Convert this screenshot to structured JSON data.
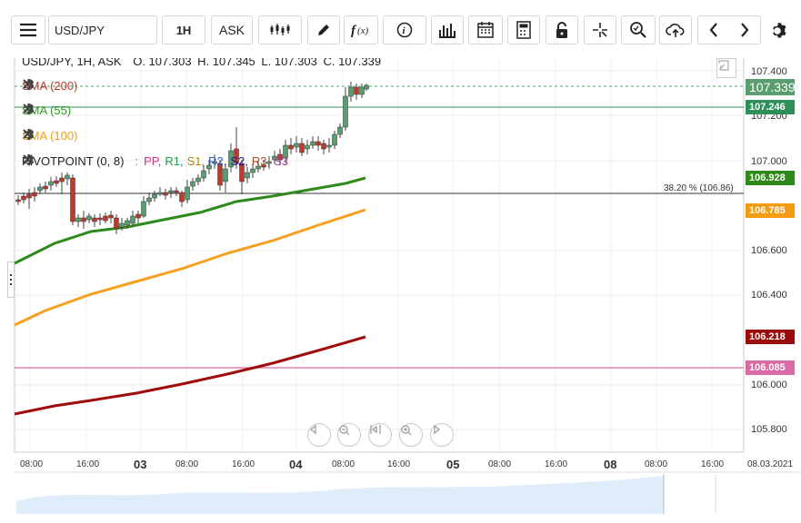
{
  "toolbar": {
    "symbol": "USD/JPY",
    "timeframe": "1H",
    "price_type": "ASK"
  },
  "header": {
    "title": "USD/JPY, 1H, ASK",
    "open": "O. 107.303",
    "high": "H. 107.345",
    "low": "L. 107.303",
    "close": "C. 107.339"
  },
  "indicators": {
    "sma200": {
      "label": "SMA (200)",
      "color": "#c0392b"
    },
    "sma55": {
      "label": "SMA (55)",
      "color": "#2e9a1a"
    },
    "sma100": {
      "label": "SMA (100)",
      "color": "#f39c12"
    },
    "pivot": {
      "label": "PIVOTPOINT (0, 8)",
      "sep": ":",
      "parts": [
        {
          "t": "PP,",
          "c": "#d63384"
        },
        {
          "t": "R1,",
          "c": "#1a9a4a"
        },
        {
          "t": "S1,",
          "c": "#b8860b"
        },
        {
          "t": "R2,",
          "c": "#2c5fb3"
        },
        {
          "t": "S2,",
          "c": "#1a1a8a"
        },
        {
          "t": "R3,",
          "c": "#a0522d"
        },
        {
          "t": "S3",
          "c": "#b03a9a"
        }
      ]
    }
  },
  "y_axis": {
    "ticks": [
      "107.400",
      "107.200",
      "107.000",
      "106.600",
      "106.400",
      "106.000",
      "105.800"
    ]
  },
  "price_tags": {
    "current": {
      "text": "107.339",
      "color": "#5a9e6f"
    },
    "sma55_top": {
      "text": "107.246",
      "color": "#2f8f5b"
    },
    "sma55": {
      "text": "106.928",
      "color": "#2e8b1a"
    },
    "sma100": {
      "text": "106.785",
      "color": "#f39c12"
    },
    "sma200": {
      "text": "106.218",
      "color": "#9b0d0d"
    },
    "pp": {
      "text": "106.085",
      "color": "#d96aa3"
    }
  },
  "fib": {
    "label": "38.20 % (106.86)"
  },
  "x_axis": {
    "labels": [
      {
        "t": "08:00",
        "b": false
      },
      {
        "t": "16:00",
        "b": false
      },
      {
        "t": "03",
        "b": true
      },
      {
        "t": "08:00",
        "b": false
      },
      {
        "t": "16:00",
        "b": false
      },
      {
        "t": "04",
        "b": true
      },
      {
        "t": "08:00",
        "b": false
      },
      {
        "t": "16:00",
        "b": false
      },
      {
        "t": "05",
        "b": true
      },
      {
        "t": "08:00",
        "b": false
      },
      {
        "t": "16:00",
        "b": false
      },
      {
        "t": "08",
        "b": true
      },
      {
        "t": "08:00",
        "b": false
      },
      {
        "t": "16:00",
        "b": false
      },
      {
        "t": "08.03.2021",
        "b": false
      }
    ]
  },
  "colors": {
    "up": "#5a9e6f",
    "down": "#c0392b",
    "sma55_line": "#2e8b1a",
    "sma100_line": "#f5a020",
    "sma200_line": "#a00c0c",
    "pp_line": "#d96aa3",
    "volume_fill": "#d6e8f7"
  }
}
